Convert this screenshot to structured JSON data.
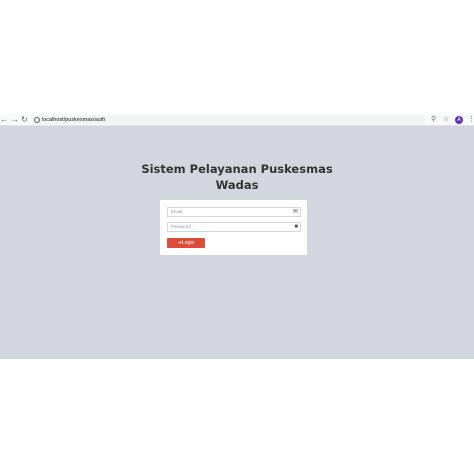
{
  "browser": {
    "url": "localhost/puskesmas/auth",
    "avatar_letter": "A",
    "icons": {
      "back": "back-arrow-icon",
      "forward": "forward-arrow-icon",
      "reload": "reload-icon",
      "zoom": "zoom-icon",
      "bookmark": "star-icon",
      "menu": "kebab-menu-icon"
    }
  },
  "page": {
    "title": "Sistem Pelayanan Puskesmas Wadas",
    "email_placeholder": "Email",
    "password_placeholder": "Password",
    "login_label": "Login",
    "colors": {
      "background": "#d2d6de",
      "box": "#ffffff",
      "button": "#dd4b39"
    }
  }
}
